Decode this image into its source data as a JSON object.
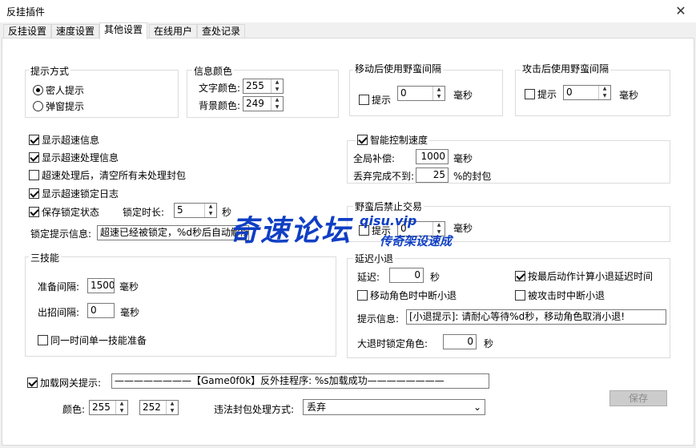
{
  "window": {
    "title": "反挂插件"
  },
  "tabs": [
    "反挂设置",
    "速度设置",
    "其他设置",
    "在线用户",
    "查处记录"
  ],
  "prompt_mode": {
    "label": "提示方式",
    "options": [
      "密人提示",
      "弹窗提示"
    ],
    "selected": 0
  },
  "info_color": {
    "label": "信息颜色",
    "text_color_label": "文字颜色:",
    "text_color_value": "255",
    "bg_color_label": "背景颜色:",
    "bg_color_value": "249"
  },
  "after_move": {
    "label": "移动后使用野蛮间隔",
    "check_label": "提示",
    "value": "0",
    "unit": "毫秒"
  },
  "after_attack": {
    "label": "攻击后使用野蛮间隔",
    "check_label": "提示",
    "value": "0",
    "unit": "毫秒"
  },
  "checks": {
    "show_speed_info": "显示超速信息",
    "show_speed_handle": "显示超速处理信息",
    "clear_packets": "超速处理后，清空所有未处理封包",
    "show_lock_log": "显示超速锁定日志",
    "save_lock_state": "保存锁定状态"
  },
  "lock": {
    "duration_label": "锁定时长:",
    "duration_value": "5",
    "duration_unit": "秒",
    "prompt_label": "锁定提示信息:",
    "prompt_value": "超速已经被锁定，%d秒后自动解除"
  },
  "smart_speed": {
    "label": "智能控制速度",
    "global_comp_label": "全局补偿:",
    "global_comp_value": "1000",
    "global_comp_unit": "毫秒",
    "discard_label": "丢弃完成不到:",
    "discard_value": "25",
    "discard_unit": "%的封包"
  },
  "barbarian_trade": {
    "label": "野蛮后禁止交易",
    "check_label": "提示",
    "value": "0",
    "unit": "毫秒"
  },
  "three_skill": {
    "label": "三技能",
    "prep_label": "准备间隔:",
    "prep_value": "1500",
    "prep_unit": "毫秒",
    "cast_label": "出招间隔:",
    "cast_value": "0",
    "cast_unit": "毫秒",
    "single_label": "同一时间单一技能准备"
  },
  "delay_logout": {
    "label": "延迟小退",
    "delay_label": "延迟:",
    "delay_value": "0",
    "delay_unit": "秒",
    "calc_last_action": "按最后动作计算小退延迟时间",
    "move_interrupt": "移动角色时中断小退",
    "attack_interrupt": "被攻击时中断小退",
    "msg_label": "提示信息:",
    "msg_value": "[小退提示]: 请耐心等待%d秒，移动角色取消小退!",
    "lock_label": "大退时锁定角色:",
    "lock_value": "0",
    "lock_unit": "秒"
  },
  "gateway": {
    "check_label": "加载网关提示:",
    "message": "————————【Game0f0k】反外挂程序: %s加载成功————————",
    "color_label": "颜色:",
    "color_value1": "255",
    "color_value2": "252",
    "handle_label": "违法封包处理方式:",
    "handle_value": "丢弃"
  },
  "save_button": "保存",
  "watermark": {
    "main": "奇速论坛",
    "url": "qisu.vip",
    "slogan": "传奇架设速成"
  }
}
